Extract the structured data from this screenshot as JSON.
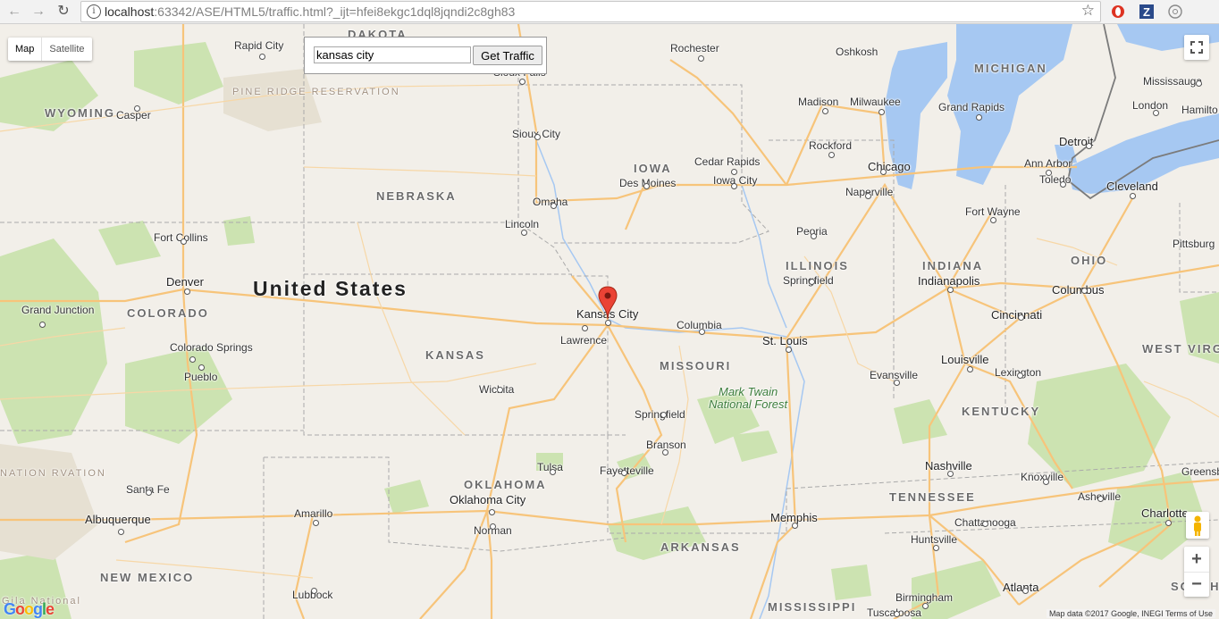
{
  "browser": {
    "url_host": "localhost",
    "url_rest": ":63342/ASE/HTML5/traffic.html?_ijt=hfei8ekgc1dql8jqndi2c8gh83",
    "icons": [
      "back-icon",
      "forward-icon",
      "reload-icon",
      "info-icon",
      "star-icon",
      "opera-icon",
      "zotero-icon",
      "extension-icon"
    ]
  },
  "controls": {
    "map_label": "Map",
    "satellite_label": "Satellite",
    "search_value": "kansas city",
    "traffic_button": "Get Traffic",
    "zoom_in": "+",
    "zoom_out": "−",
    "footer": "Map data ©2017 Google, INEGI   Terms of Use",
    "logo": "Google"
  },
  "map": {
    "country": "United States",
    "marker_city": "Kansas City",
    "states": [
      "DAKOTA",
      "WYOMING",
      "NEBRASKA",
      "IOWA",
      "COLORADO",
      "KANSAS",
      "ILLINOIS",
      "INDIANA",
      "OHIO",
      "MICHIGAN",
      "MISSOURI",
      "WEST VIRGINIA",
      "KENTUCKY",
      "OKLAHOMA",
      "TENNESSEE",
      "ARKANSAS",
      "NEW MEXICO",
      "MISSISSIPPI",
      "SOUTH CARO"
    ],
    "regions": [
      "PINE RIDGE RESERVATION",
      "NATION RVATION",
      "Gila National"
    ],
    "forest": [
      "Mark Twain",
      "National Forest"
    ],
    "cities": [
      "Rapid City",
      "Sioux Falls",
      "Rochester",
      "Oshkosh",
      "Mississauga",
      "Hamilto",
      "Casper",
      "Sioux City",
      "Madison",
      "Milwaukee",
      "Grand Rapids",
      "London",
      "Rockford",
      "Detroit",
      "Cedar Rapids",
      "Ann Arbor",
      "Des Moines",
      "Iowa City",
      "Chicago",
      "Naperville",
      "Toledo",
      "Cleveland",
      "Omaha",
      "Fort Wayne",
      "Lincoln",
      "Peoria",
      "Pittsburg",
      "Fort Collins",
      "Springfield",
      "Indianapolis",
      "Columbus",
      "Denver",
      "Grand Junction",
      "Lawrence",
      "Columbia",
      "St. Louis",
      "Cincinnati",
      "Colorado Springs",
      "Pueblo",
      "Louisville",
      "Evansville",
      "Lexington",
      "Wichita",
      "Springfield",
      "Branson",
      "Nashville",
      "Knoxville",
      "Greensb",
      "Tulsa",
      "Fayetteville",
      "Oklahoma City",
      "Santa Fe",
      "Amarillo",
      "Asheville",
      "Albuquerque",
      "Memphis",
      "Charlotte",
      "Norman",
      "Chattanooga",
      "Huntsville",
      "Lubbock",
      "Birmingham",
      "Atlanta",
      "Tuscaloosa"
    ]
  }
}
